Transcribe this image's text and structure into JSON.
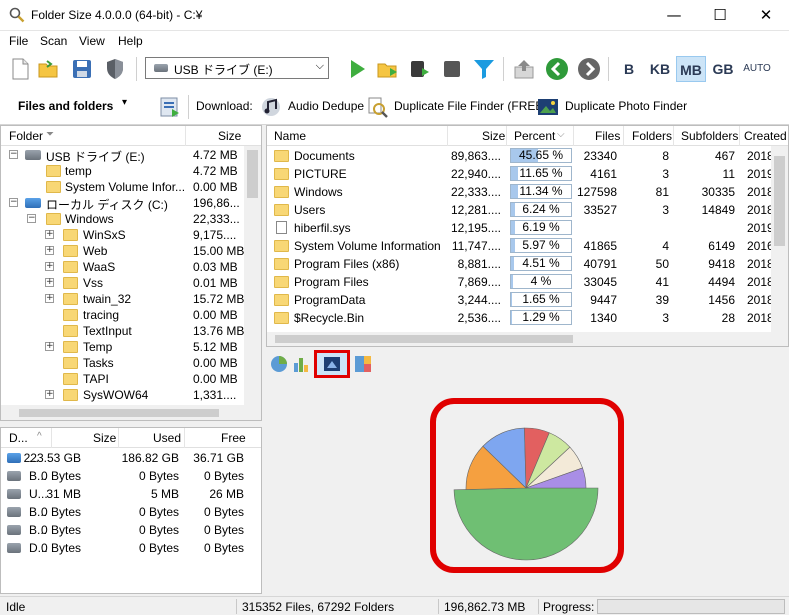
{
  "window": {
    "title": "Folder Size 4.0.0.0 (64-bit) - C:¥",
    "minimize": "—",
    "maximize": "☐",
    "close": "✕"
  },
  "menu": [
    "File",
    "Scan",
    "View",
    "Help"
  ],
  "toolbar": {
    "drive_combo": "USB ドライブ (E:)",
    "units": [
      "B",
      "KB",
      "MB",
      "GB",
      "AUTO"
    ],
    "active_unit": "MB",
    "view_selector": "Files and folders",
    "download_label": "Download:",
    "downloads": [
      "Audio Dedupe",
      "Duplicate File Finder (FREE)",
      "Duplicate Photo Finder"
    ]
  },
  "tree": {
    "headers": {
      "folder": "Folder",
      "size": "Size"
    },
    "items": [
      {
        "name": "USB ドライブ (E:)",
        "size": "4.72 MB",
        "level": 0,
        "type": "drive",
        "exp": "−"
      },
      {
        "name": "temp",
        "size": "4.72 MB",
        "level": 1,
        "type": "folder",
        "exp": ""
      },
      {
        "name": "System Volume Infor...",
        "size": "0.00 MB",
        "level": 1,
        "type": "folder",
        "exp": ""
      },
      {
        "name": "ローカル ディスク (C:)",
        "size": "196,86...",
        "level": 0,
        "type": "windrive",
        "exp": "−"
      },
      {
        "name": "Windows",
        "size": "22,333...",
        "level": 1,
        "type": "folder",
        "exp": "−"
      },
      {
        "name": "WinSxS",
        "size": "9,175....",
        "level": 2,
        "type": "folder",
        "exp": "+"
      },
      {
        "name": "Web",
        "size": "15.00 MB",
        "level": 2,
        "type": "folder",
        "exp": "+"
      },
      {
        "name": "WaaS",
        "size": "0.03 MB",
        "level": 2,
        "type": "folder",
        "exp": "+"
      },
      {
        "name": "Vss",
        "size": "0.01 MB",
        "level": 2,
        "type": "folder",
        "exp": "+"
      },
      {
        "name": "twain_32",
        "size": "15.72 MB",
        "level": 2,
        "type": "folder",
        "exp": "+"
      },
      {
        "name": "tracing",
        "size": "0.00 MB",
        "level": 2,
        "type": "folder",
        "exp": ""
      },
      {
        "name": "TextInput",
        "size": "13.76 MB",
        "level": 2,
        "type": "folder",
        "exp": ""
      },
      {
        "name": "Temp",
        "size": "5.12 MB",
        "level": 2,
        "type": "folder",
        "exp": "+"
      },
      {
        "name": "Tasks",
        "size": "0.00 MB",
        "level": 2,
        "type": "folder",
        "exp": ""
      },
      {
        "name": "TAPI",
        "size": "0.00 MB",
        "level": 2,
        "type": "folder",
        "exp": ""
      },
      {
        "name": "SysWOW64",
        "size": "1,331....",
        "level": 2,
        "type": "folder",
        "exp": "+"
      }
    ]
  },
  "drives": {
    "headers": {
      "drive": "D...",
      "size": "Size",
      "used": "Used",
      "free": "Free"
    },
    "rows": [
      {
        "name": "...",
        "size": "223.53 GB",
        "used": "186.82 GB",
        "free": "36.71 GB",
        "type": "win"
      },
      {
        "name": "B...",
        "size": "0 Bytes",
        "used": "0 Bytes",
        "free": "0 Bytes",
        "type": "hdd"
      },
      {
        "name": "U...",
        "size": "31 MB",
        "used": "5 MB",
        "free": "26 MB",
        "type": "usb"
      },
      {
        "name": "B...",
        "size": "0 Bytes",
        "used": "0 Bytes",
        "free": "0 Bytes",
        "type": "hdd"
      },
      {
        "name": "B...",
        "size": "0 Bytes",
        "used": "0 Bytes",
        "free": "0 Bytes",
        "type": "hdd"
      },
      {
        "name": "D...",
        "size": "0 Bytes",
        "used": "0 Bytes",
        "free": "0 Bytes",
        "type": "hdd"
      }
    ]
  },
  "files": {
    "headers": {
      "name": "Name",
      "size": "Size",
      "percent": "Percent",
      "files": "Files",
      "folders": "Folders",
      "subfolders": "Subfolders",
      "created": "Created"
    },
    "rows": [
      {
        "name": "Documents",
        "size": "89,863....",
        "percent": "45.65 %",
        "pct": 45.65,
        "files": "23340",
        "folders": "8",
        "subfolders": "467",
        "created": "2018",
        "type": "folder",
        "selected": true
      },
      {
        "name": "PICTURE",
        "size": "22,940....",
        "percent": "11.65 %",
        "pct": 11.65,
        "files": "4161",
        "folders": "3",
        "subfolders": "11",
        "created": "2019",
        "type": "folder"
      },
      {
        "name": "Windows",
        "size": "22,333....",
        "percent": "11.34 %",
        "pct": 11.34,
        "files": "127598",
        "folders": "81",
        "subfolders": "30335",
        "created": "2018",
        "type": "folder"
      },
      {
        "name": "Users",
        "size": "12,281....",
        "percent": "6.24 %",
        "pct": 6.24,
        "files": "33527",
        "folders": "3",
        "subfolders": "14849",
        "created": "2018",
        "type": "folder"
      },
      {
        "name": "hiberfil.sys",
        "size": "12,195....",
        "percent": "6.19 %",
        "pct": 6.19,
        "files": "",
        "folders": "",
        "subfolders": "",
        "created": "2019",
        "type": "file"
      },
      {
        "name": "System Volume Information",
        "size": "11,747....",
        "percent": "5.97 %",
        "pct": 5.97,
        "files": "41865",
        "folders": "4",
        "subfolders": "6149",
        "created": "2016",
        "type": "folder"
      },
      {
        "name": "Program Files (x86)",
        "size": "8,881....",
        "percent": "4.51 %",
        "pct": 4.51,
        "files": "40791",
        "folders": "50",
        "subfolders": "9418",
        "created": "2018",
        "type": "folder"
      },
      {
        "name": "Program Files",
        "size": "7,869....",
        "percent": "4 %",
        "pct": 4,
        "files": "33045",
        "folders": "41",
        "subfolders": "4494",
        "created": "2018",
        "type": "folder"
      },
      {
        "name": "ProgramData",
        "size": "3,244....",
        "percent": "1.65 %",
        "pct": 1.65,
        "files": "9447",
        "folders": "39",
        "subfolders": "1456",
        "created": "2018",
        "type": "folder"
      },
      {
        "name": "$Recycle.Bin",
        "size": "2,536....",
        "percent": "1.29 %",
        "pct": 1.29,
        "files": "1340",
        "folders": "3",
        "subfolders": "28",
        "created": "2018",
        "type": "folder"
      }
    ]
  },
  "chart_data": {
    "type": "pie",
    "values": [
      45.65,
      11.65,
      11.34,
      6.24,
      6.19,
      5.97
    ],
    "colors": [
      "#6fbf73",
      "#f5a040",
      "#7ea6f0",
      "#e26060",
      "#cde8a0",
      "#f3ead8"
    ],
    "highlight_color": "#a98ee6",
    "legend": "none"
  },
  "colors": {
    "accent": "#0078d7",
    "highlight_box": "#e00000"
  },
  "status": {
    "state": "Idle",
    "counts": "315352 Files, 67292 Folders",
    "total": "196,862.73 MB",
    "progress_label": "Progress:"
  }
}
